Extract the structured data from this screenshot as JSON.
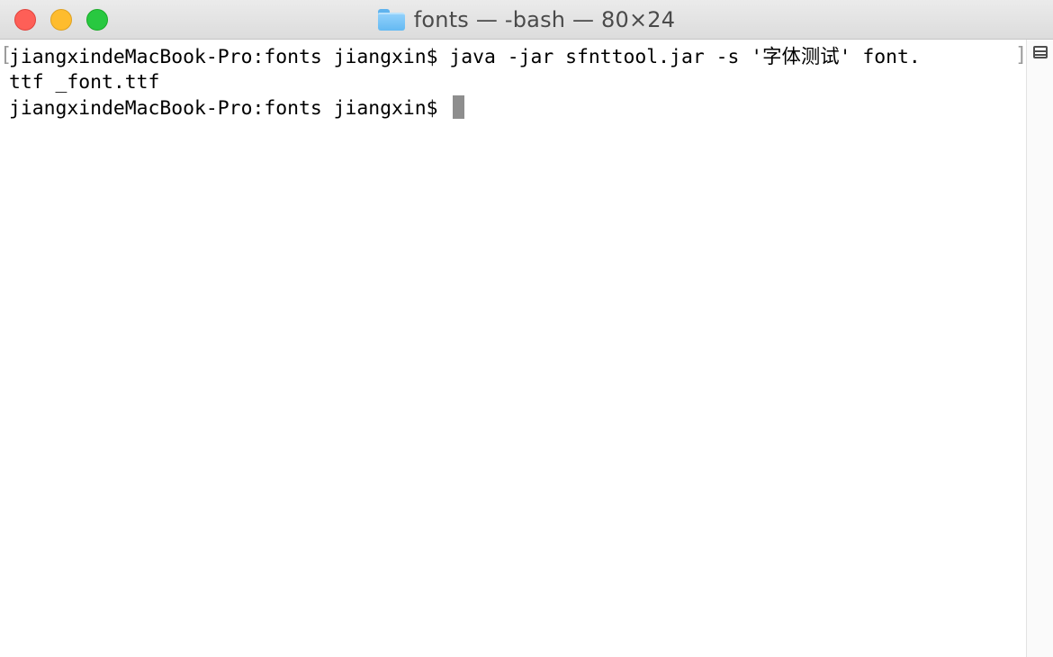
{
  "window": {
    "title": "fonts — -bash — 80×24",
    "controls": {
      "close_color": "#fe5f57",
      "minimize_color": "#febc2e",
      "zoom_color": "#28c840"
    }
  },
  "terminal": {
    "lines": [
      "jiangxindeMacBook-Pro:fonts jiangxin$ java -jar sfnttool.jar -s '字体测试' font.",
      "ttf _font.ttf",
      "jiangxindeMacBook-Pro:fonts jiangxin$ "
    ],
    "wrap_marker_left": "[",
    "wrap_marker_right": "]",
    "cursor_color": "#8e8e8e"
  },
  "icons": {
    "folder": "folder-icon",
    "split_pane": "split-pane-icon"
  }
}
